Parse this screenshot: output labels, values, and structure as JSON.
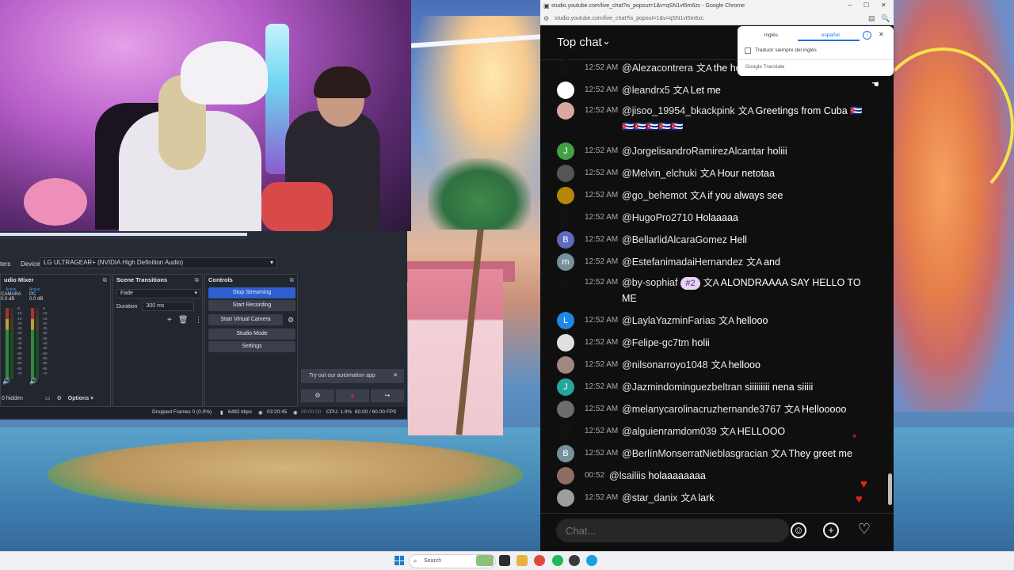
{
  "browser": {
    "window_title": "studio.youtube.com/live_chat?is_popout=1&v=qSN1vt5m6zc - Google Chrome",
    "url": "studio.youtube.com/live_chat?is_popout=1&v=qSN1vt5m6zc"
  },
  "chat": {
    "header_title": "Top chat",
    "input_placeholder": "Chat...",
    "messages": [
      {
        "time": "12:52 AM",
        "author": "@Alezacontrera",
        "translated": true,
        "text": "the he",
        "avatar_letter": "",
        "avatar_color": "#111111"
      },
      {
        "time": "12:52 AM",
        "author": "@leandrx5",
        "translated": true,
        "text": "Let me",
        "avatar_letter": "",
        "avatar_color": "#ffffff"
      },
      {
        "time": "12:52 AM",
        "author": "@jisoo_19954_bkackpink",
        "translated": true,
        "text": "Greetings from Cuba 🇨🇺 🇨🇺🇨🇺🇨🇺🇨🇺🇨🇺",
        "avatar_letter": "",
        "avatar_color": "#d9a8a0"
      },
      {
        "time": "12:52 AM",
        "author": "@JorgelisandroRamirezAlcantar",
        "translated": false,
        "text": "holiii",
        "avatar_letter": "J",
        "avatar_color": "#43a047"
      },
      {
        "time": "12:52 AM",
        "author": "@Melvin_elchuki",
        "translated": true,
        "text": "Hour netotaa",
        "avatar_letter": "",
        "avatar_color": "#555555"
      },
      {
        "time": "12:52 AM",
        "author": "@go_behemot",
        "translated": true,
        "text": "if you always see",
        "avatar_letter": "",
        "avatar_color": "#b8860b"
      },
      {
        "time": "12:52 AM",
        "author": "@HugoPro2710",
        "translated": false,
        "text": "Holaaaaa",
        "avatar_letter": "",
        "avatar_color": "#111111"
      },
      {
        "time": "12:52 AM",
        "author": "@BellarlidAlcaraGomez",
        "translated": false,
        "text": "Hell",
        "avatar_letter": "B",
        "avatar_color": "#5c6bc0"
      },
      {
        "time": "12:52 AM",
        "author": "@EstefanimadaiHernandez",
        "translated": true,
        "text": "and",
        "avatar_letter": "m",
        "avatar_color": "#78909c"
      },
      {
        "time": "12:52 AM",
        "author": "@by-sophiaf",
        "translated": true,
        "text": "ALONDRAAAA SAY HELLO TO ME",
        "membership": "#2",
        "avatar_letter": "",
        "avatar_color": "#111111"
      },
      {
        "time": "12:52 AM",
        "author": "@LaylaYazminFarias",
        "translated": true,
        "text": "hellooo",
        "avatar_letter": "L",
        "avatar_color": "#1e88e5"
      },
      {
        "time": "12:52 AM",
        "author": "@Felipe-gc7tm",
        "translated": false,
        "text": "holii",
        "avatar_letter": "",
        "avatar_color": "#e0e0e0"
      },
      {
        "time": "12:52 AM",
        "author": "@nilsonarroyo1048",
        "translated": true,
        "text": "hellooo",
        "avatar_letter": "",
        "avatar_color": "#a1887f"
      },
      {
        "time": "12:52 AM",
        "author": "@Jazmindominguezbeltran",
        "translated": false,
        "text": "siiiiiiiii nena siiiii",
        "avatar_letter": "J",
        "avatar_color": "#26a69a"
      },
      {
        "time": "12:52 AM",
        "author": "@melanycarolinacruzhernande3767",
        "translated": true,
        "text": "Hellooooo",
        "avatar_letter": "",
        "avatar_color": "#6d6d6d"
      },
      {
        "time": "12:52 AM",
        "author": "@alguienramdom039",
        "translated": true,
        "text": "HELLOOO",
        "avatar_letter": "",
        "avatar_color": "#111111"
      },
      {
        "time": "12:52 AM",
        "author": "@BerlínMonserratNieblasgracian",
        "translated": true,
        "text": "They greet me",
        "avatar_letter": "B",
        "avatar_color": "#78909c"
      },
      {
        "time": "00:52",
        "author": "@lsailiis",
        "translated": false,
        "text": "holaaaaaaaa",
        "avatar_letter": "",
        "avatar_color": "#8d6e63"
      },
      {
        "time": "12:52 AM",
        "author": "@star_danix",
        "translated": true,
        "text": "lark",
        "avatar_letter": "",
        "avatar_color": "#9e9e9e"
      }
    ]
  },
  "translate_popup": {
    "lang_from": "inglés",
    "lang_to": "español",
    "checkbox_label": "Traducir siempre del inglés",
    "footer": "Google Translate"
  },
  "obs": {
    "device_label": "Device",
    "device_value": "LG ULTRAGEAR+ (NVIDIA High Definition Audio)",
    "filters_label": "ters",
    "audio_mixer_title": "udio Mixer",
    "mixer_channels": [
      {
        "name": "CAMARA",
        "status": "Active",
        "level": "0.0 dB"
      },
      {
        "name": "PC",
        "status": "Active",
        "level": "0.0 dB"
      }
    ],
    "hidden_label": "0 hidden",
    "options_label": "Options",
    "scene_transitions_title": "Scene Transitions",
    "transition_value": "Fade",
    "duration_label": "Duration",
    "duration_value": "300 ms",
    "controls_title": "Controls",
    "btn_stop_streaming": "Stop Streaming",
    "btn_start_recording": "Start Recording",
    "btn_start_virtual_camera": "Start Virtual Camera",
    "btn_studio_mode": "Studio Mode",
    "btn_settings": "Settings",
    "automation_text": "Try out our automation app",
    "status": {
      "dropped_frames": "Dropped Frames 0 (0.0%)",
      "bitrate": "6482 kbps",
      "live_time": "03:20:45",
      "rec_time": "00:00:00",
      "cpu": "CPU: 1.0%",
      "fps": "60.00 / 60.00 FPS"
    }
  },
  "taskbar": {
    "search_label": "Search"
  },
  "colors": {
    "chat_bg": "#0f0f0f",
    "obs_accent": "#2f5fd0",
    "heart": "#e62117"
  }
}
